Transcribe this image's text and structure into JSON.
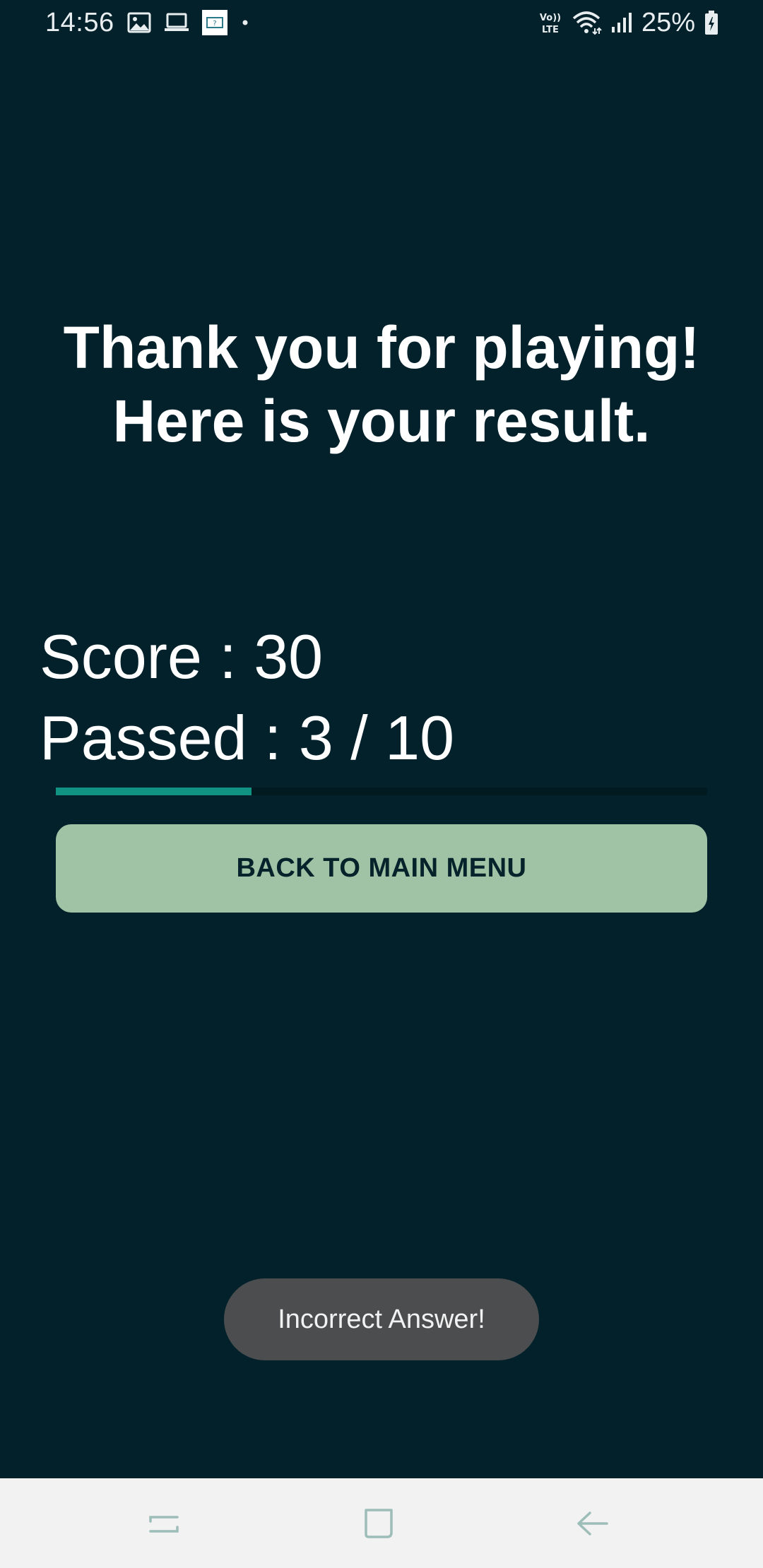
{
  "status_bar": {
    "time": "14:56",
    "battery_percent": "25%",
    "icons_left": [
      "image-icon",
      "laptop-icon",
      "app-notification-icon",
      "dot-icon"
    ],
    "icons_right": [
      "volte-icon",
      "wifi-icon",
      "signal-icon",
      "battery-charging-icon"
    ]
  },
  "result": {
    "title_line1": "Thank you for playing!",
    "title_line2": "Here is your result.",
    "score_text": "Score : 30",
    "passed_text": "Passed : 3 / 10",
    "progress_fraction": 0.3
  },
  "button": {
    "label": "BACK TO MAIN MENU"
  },
  "toast": {
    "message": "Incorrect Answer!"
  },
  "nav_bar": {
    "buttons": [
      "recents-icon",
      "home-icon",
      "back-icon"
    ]
  },
  "colors": {
    "background": "#02212b",
    "button": "#9fc3a4",
    "progress": "#119384",
    "toast": "#4c4d4e"
  }
}
